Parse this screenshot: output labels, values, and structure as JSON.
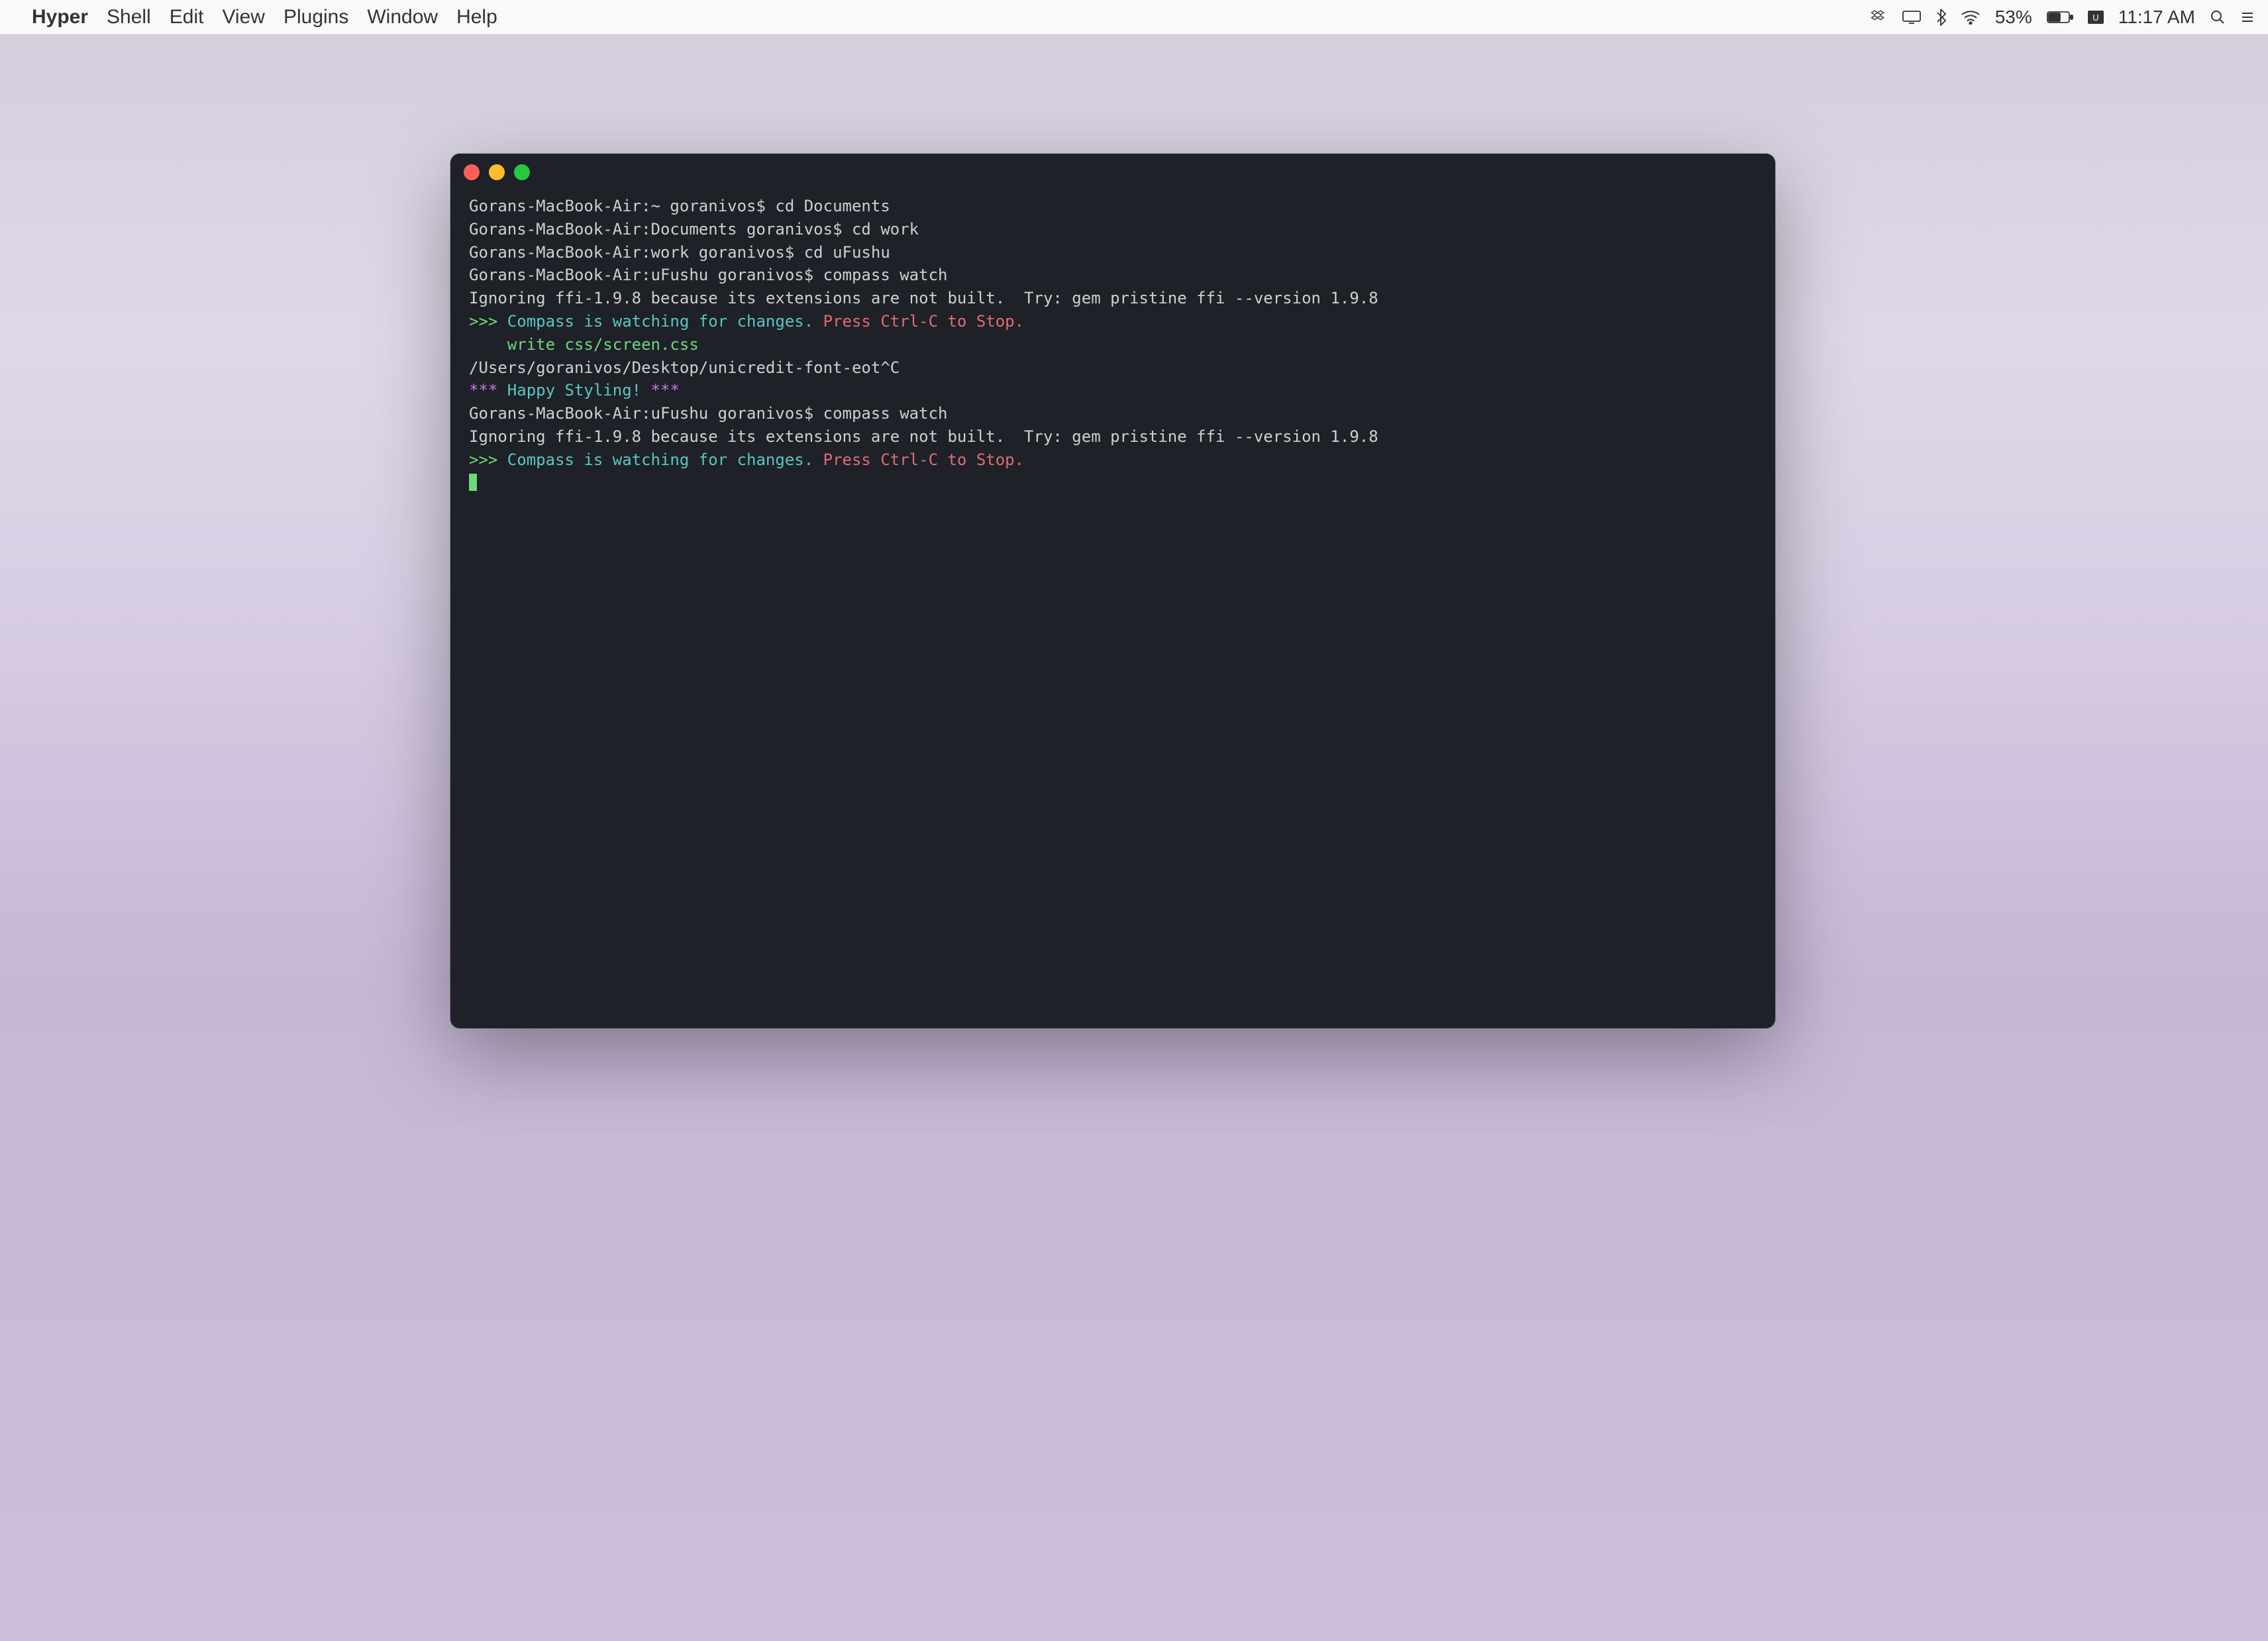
{
  "menubar": {
    "app_name": "Hyper",
    "items": [
      "Shell",
      "Edit",
      "View",
      "Plugins",
      "Window",
      "Help"
    ],
    "battery_pct": "53%",
    "clock": "11:17 AM"
  },
  "terminal": {
    "lines": [
      {
        "segments": [
          {
            "cls": "w",
            "t": "Gorans-MacBook-Air:~ goranivos$ cd Documents"
          }
        ]
      },
      {
        "segments": [
          {
            "cls": "w",
            "t": "Gorans-MacBook-Air:Documents goranivos$ cd work"
          }
        ]
      },
      {
        "segments": [
          {
            "cls": "w",
            "t": "Gorans-MacBook-Air:work goranivos$ cd uFushu"
          }
        ]
      },
      {
        "segments": [
          {
            "cls": "w",
            "t": "Gorans-MacBook-Air:uFushu goranivos$ compass watch"
          }
        ]
      },
      {
        "segments": [
          {
            "cls": "w",
            "t": "Ignoring ffi-1.9.8 because its extensions are not built.  Try: gem pristine ffi --version 1.9.8"
          }
        ]
      },
      {
        "segments": [
          {
            "cls": "g",
            "t": ">>> "
          },
          {
            "cls": "c",
            "t": "Compass is watching for changes. "
          },
          {
            "cls": "r",
            "t": "Press Ctrl-C to Stop."
          }
        ]
      },
      {
        "segments": [
          {
            "cls": "g",
            "t": "    write css/screen.css"
          }
        ]
      },
      {
        "segments": [
          {
            "cls": "w",
            "t": "/Users/goranivos/Desktop/unicredit-font-eot^C"
          }
        ]
      },
      {
        "segments": [
          {
            "cls": "mag",
            "t": "*** "
          },
          {
            "cls": "c",
            "t": "Happy Styling!"
          },
          {
            "cls": "mag",
            "t": " ***"
          }
        ]
      },
      {
        "segments": [
          {
            "cls": "w",
            "t": "Gorans-MacBook-Air:uFushu goranivos$ compass watch"
          }
        ]
      },
      {
        "segments": [
          {
            "cls": "w",
            "t": "Ignoring ffi-1.9.8 because its extensions are not built.  Try: gem pristine ffi --version 1.9.8"
          }
        ]
      },
      {
        "segments": [
          {
            "cls": "g",
            "t": ">>> "
          },
          {
            "cls": "c",
            "t": "Compass is watching for changes. "
          },
          {
            "cls": "r",
            "t": "Press Ctrl-C to Stop."
          }
        ]
      }
    ]
  }
}
